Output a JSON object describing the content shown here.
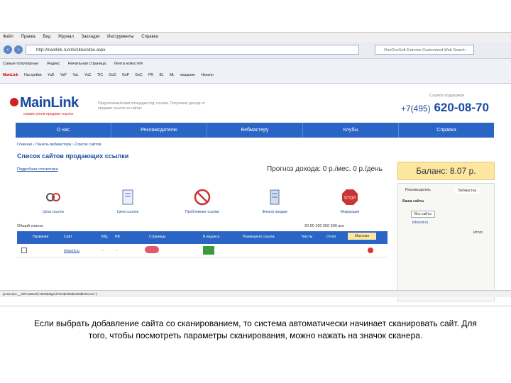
{
  "browser": {
    "menu": [
      "Файл",
      "Правка",
      "Вид",
      "Журнал",
      "Закладки",
      "Инструменты",
      "Справка"
    ],
    "url": "http://mainlink.ru/xmi/sites/sites.aspx",
    "search_placeholder": "OneOneSoft Extreme Customized Web Search",
    "bookmarks": [
      "Самые популярные",
      "Яндекс",
      "Начальная страница",
      "Лента новостей"
    ],
    "toolbar2": [
      "MainLink",
      "Настройки",
      "YaD",
      "YaP",
      "YaL",
      "YaC",
      "TIC",
      "GoD",
      "GoP",
      "GoC",
      "PR",
      "BL",
      "ML",
      "вещание",
      "Начало"
    ],
    "status": "javascript:__doPostBack('ctl00$c$gridView$ctl02$ctl00$lnkScan','')"
  },
  "site": {
    "logo": "MainLink",
    "logo_sub": "сервис купли-продажи ссылок",
    "slogan": "Предлагаемый вам площадки под: ссылки. Получение дохода от продажи ссылок на сайтах",
    "support_label": "Служба поддержки",
    "phone_prefix": "+7(495)",
    "phone": "620-08-70",
    "nav": [
      "О нас",
      "Рекламодателю",
      "Вебмастеру",
      "Клубы",
      "Справка"
    ],
    "breadcrumb": "Главная › Панель вебмастера › Список сайтов",
    "title": "Список сайтов продающих ссылки",
    "stats_link": "Подробная статистика",
    "forecast": "Прогноз дохода: 0 р./мес. 0 р./день",
    "balance": "Баланс: 8.07 р.",
    "tools": [
      "Цена ссылок",
      "Цена ссылок",
      "Проблемные ссылки",
      "Фильтр продаж",
      "Модерация"
    ],
    "table_count": "Общий список",
    "pagesize": "20 50 100 200 500 все",
    "columns": [
      "Название",
      "Сайт",
      "тИЦ",
      "PR",
      "Страницы",
      "В индексе",
      "Размещено ссылок",
      "Тексты",
      "Отчет",
      "Массово"
    ],
    "row": {
      "site": "lohcent.ru",
      "tic": "-",
      "pr": "-"
    },
    "rightpanel": {
      "tab1": "Рекламодатель",
      "tab2": "Вебмастер",
      "sites_label": "Ваши сайты",
      "all_sites": "Все сайты",
      "site": "lohcent.ru",
      "total": "Итого"
    }
  },
  "caption": "Если выбрать добавление сайта со сканированием, то система автоматически начинает сканировать сайт. Для того, чтобы посмотреть параметры сканирования, можно нажать на значок сканера."
}
